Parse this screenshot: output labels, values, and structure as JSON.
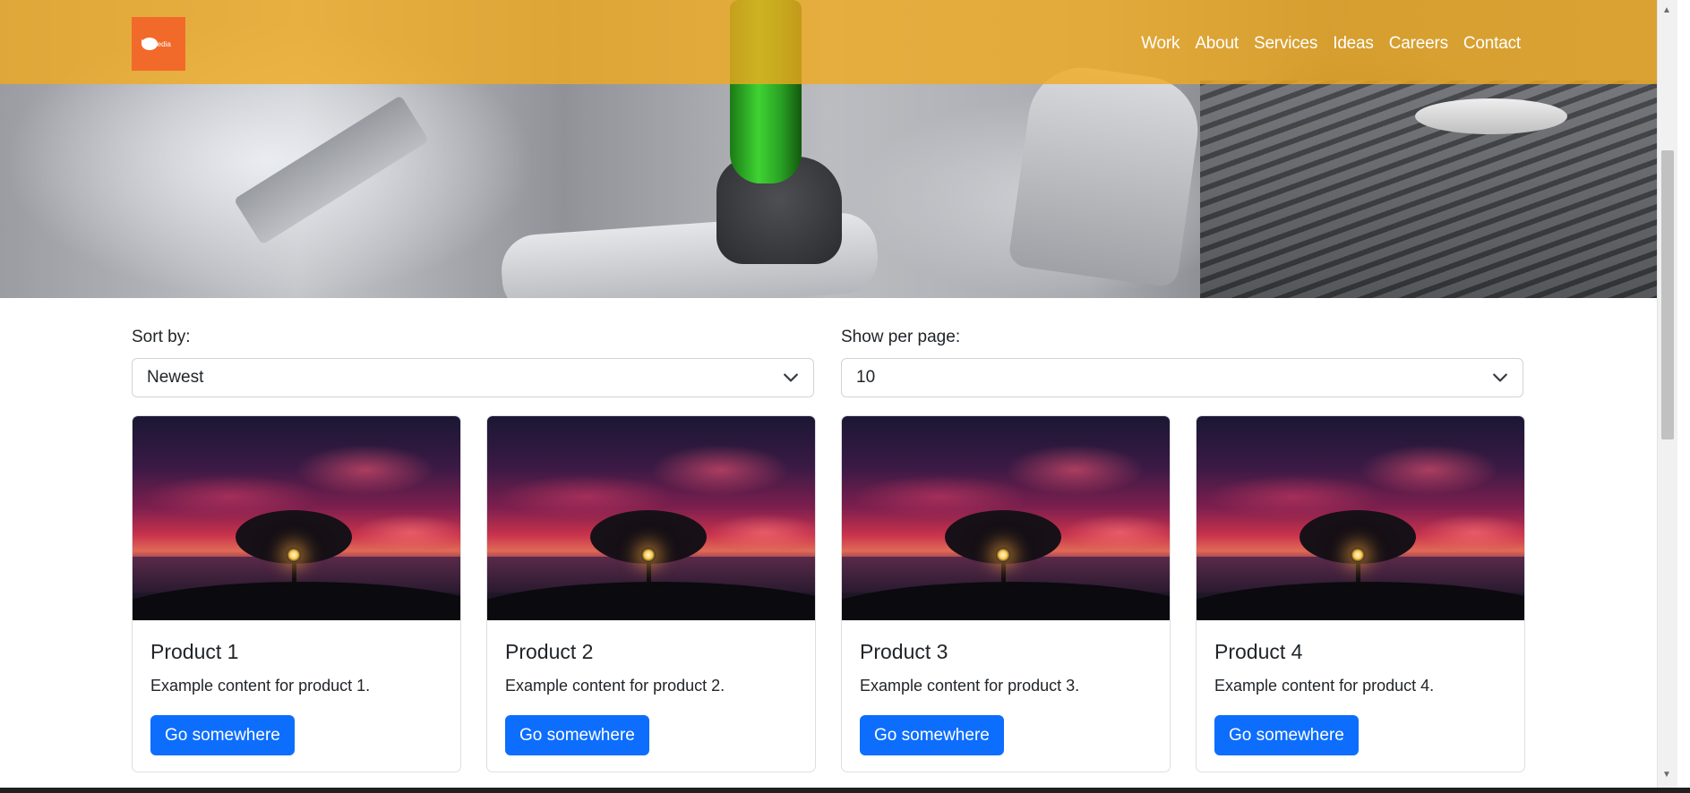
{
  "brand": {
    "logo_text": "media",
    "logo_color": "#f26a2a",
    "navbar_color": "#f0aa1e"
  },
  "nav": {
    "links": [
      "Work",
      "About",
      "Services",
      "Ideas",
      "Careers",
      "Contact"
    ]
  },
  "filters": {
    "sort_label": "Sort by:",
    "sort_value": "Newest",
    "per_page_label": "Show per page:",
    "per_page_value": "10"
  },
  "products": [
    {
      "title": "Product 1",
      "text": "Example content for product 1.",
      "button": "Go somewhere"
    },
    {
      "title": "Product 2",
      "text": "Example content for product 2.",
      "button": "Go somewhere"
    },
    {
      "title": "Product 3",
      "text": "Example content for product 3.",
      "button": "Go somewhere"
    },
    {
      "title": "Product 4",
      "text": "Example content for product 4.",
      "button": "Go somewhere"
    }
  ],
  "colors": {
    "primary_button": "#0d6efd"
  },
  "icons": {
    "select_chevron": "chevron-down-icon",
    "scroll_up": "scroll-up-arrow-icon",
    "scroll_down": "scroll-down-arrow-icon"
  }
}
